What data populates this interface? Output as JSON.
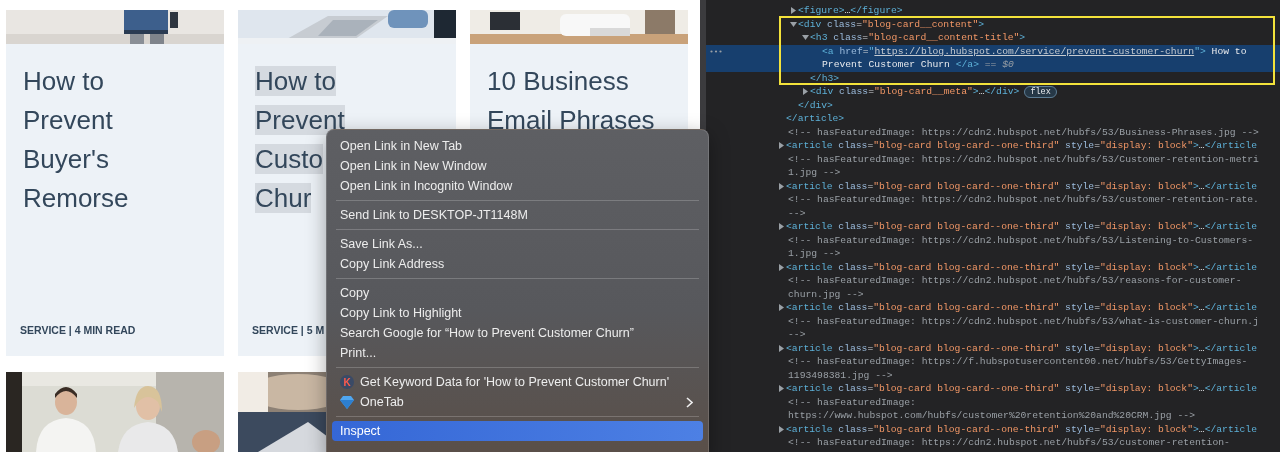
{
  "cards": [
    {
      "image": {
        "kind": "picture"
      },
      "title": [
        "How to",
        "Prevent",
        "Buyer's",
        "Remorse"
      ],
      "highlighted": false,
      "meta": "SERVICE | 4 MIN READ"
    },
    {
      "image": {
        "kind": "picture"
      },
      "title": [
        "How to",
        "Prevent",
        "Custo",
        "Chur"
      ],
      "highlighted": true,
      "meta": "SERVICE | 5 M"
    },
    {
      "image": {
        "kind": "picture"
      },
      "title": [
        "10 Business",
        "Email Phrases"
      ],
      "highlighted": false
    }
  ],
  "more_cards": [
    {
      "image": {
        "kind": "picture"
      }
    },
    {
      "image": {
        "kind": "picture"
      }
    }
  ],
  "context_menu": {
    "items": [
      {
        "kind": "item",
        "label": "Open Link in New Tab",
        "selected": false,
        "submenu": false
      },
      {
        "kind": "item",
        "label": "Open Link in New Window",
        "selected": false,
        "submenu": false
      },
      {
        "kind": "item",
        "label": "Open Link in Incognito Window",
        "selected": false,
        "submenu": false
      },
      {
        "kind": "separator"
      },
      {
        "kind": "item",
        "label": "Send Link to DESKTOP-JT1148M",
        "selected": false,
        "submenu": false
      },
      {
        "kind": "separator"
      },
      {
        "kind": "item",
        "label": "Save Link As...",
        "selected": false,
        "submenu": false
      },
      {
        "kind": "item",
        "label": "Copy Link Address",
        "selected": false,
        "submenu": false
      },
      {
        "kind": "separator"
      },
      {
        "kind": "item",
        "label": "Copy",
        "selected": false,
        "submenu": false
      },
      {
        "kind": "item",
        "label": "Copy Link to Highlight",
        "selected": false,
        "submenu": false
      },
      {
        "kind": "item",
        "label": "Search Google for “How to Prevent Customer Churn”",
        "selected": false,
        "submenu": false
      },
      {
        "kind": "item",
        "label": "Print...",
        "selected": false,
        "submenu": false
      },
      {
        "kind": "separator"
      },
      {
        "kind": "item",
        "label": "Get Keyword Data for 'How to Prevent Customer Churn'",
        "badge": "K",
        "selected": false,
        "submenu": false
      },
      {
        "kind": "gem-item",
        "label": "OneTab",
        "selected": false,
        "submenu": true
      },
      {
        "kind": "separator"
      },
      {
        "kind": "item",
        "label": "Inspect",
        "selected": true,
        "submenu": false
      }
    ]
  },
  "devtools": {
    "elements": [
      {
        "kind": "element",
        "children": [
          {
            "kind": "element",
            "expanded": false,
            "lines": [
              [
                {
                  "kind": "tag",
                  "text": "<figure>"
                },
                {
                  "kind": "text",
                  "text": "…"
                },
                {
                  "kind": "tag",
                  "text": "</figure>"
                }
              ]
            ]
          },
          {
            "kind": "element",
            "expanded": true,
            "lines": [
              [
                {
                  "kind": "tag",
                  "text": "<div"
                },
                {
                  "kind": "attr",
                  "text": " class"
                },
                {
                  "kind": "punct",
                  "text": "="
                },
                {
                  "kind": "value",
                  "text": "\"blog-card__content\""
                },
                {
                  "kind": "tag",
                  "text": ">"
                }
              ]
            ],
            "children": [
              {
                "kind": "element",
                "expanded": true,
                "lines": [
                  [
                    {
                      "kind": "tag",
                      "text": "<h3"
                    },
                    {
                      "kind": "attr",
                      "text": " class"
                    },
                    {
                      "kind": "punct",
                      "text": "="
                    },
                    {
                      "kind": "value",
                      "text": "\"blog-card__content-title\""
                    },
                    {
                      "kind": "tag",
                      "text": ">"
                    }
                  ]
                ],
                "children": [
                  {
                    "kind": "element",
                    "selected": true,
                    "lines": [
                      [
                        {
                          "kind": "tag",
                          "text": "<a"
                        },
                        {
                          "kind": "attr",
                          "text": " href"
                        },
                        {
                          "kind": "punct",
                          "text": "="
                        },
                        {
                          "kind": "tag",
                          "text": "\""
                        },
                        {
                          "kind": "link",
                          "text": "https://blog.hubspot.com/service/prevent-customer-churn"
                        },
                        {
                          "kind": "tag",
                          "text": "\">"
                        },
                        {
                          "kind": "text",
                          "text": " How to"
                        }
                      ],
                      [
                        {
                          "kind": "text",
                          "text": "Prevent Customer Churn "
                        },
                        {
                          "kind": "tag",
                          "text": "</a>"
                        },
                        {
                          "kind": "dim",
                          "text": " == $0"
                        }
                      ]
                    ]
                  }
                ],
                "close": [
                  {
                    "kind": "tag",
                    "text": "</h3>"
                  }
                ]
              },
              {
                "kind": "element",
                "expanded": false,
                "badge": "flex",
                "lines": [
                  [
                    {
                      "kind": "tag",
                      "text": "<div"
                    },
                    {
                      "kind": "attr",
                      "text": " class"
                    },
                    {
                      "kind": "punct",
                      "text": "="
                    },
                    {
                      "kind": "value",
                      "text": "\"blog-card__meta\""
                    },
                    {
                      "kind": "tag",
                      "text": ">"
                    },
                    {
                      "kind": "text",
                      "text": "…"
                    },
                    {
                      "kind": "tag",
                      "text": "</div>"
                    }
                  ]
                ]
              }
            ],
            "close": [
              {
                "kind": "tag",
                "text": "</div>"
              }
            ]
          }
        ],
        "close": [
          {
            "kind": "tag",
            "text": "</article>"
          }
        ]
      },
      {
        "kind": "comment",
        "lines": [
          [
            {
              "kind": "comment",
              "text": "<!-- hasFeaturedImage: https://cdn2.hubspot.net/hubfs/53/Business-Phrases.jpg -->"
            }
          ]
        ]
      },
      {
        "kind": "element",
        "expanded": false,
        "lines": [
          [
            {
              "kind": "tag",
              "text": "<article"
            },
            {
              "kind": "attr",
              "text": " class"
            },
            {
              "kind": "punct",
              "text": "="
            },
            {
              "kind": "value",
              "text": "\"blog-card blog-card--one-third\""
            },
            {
              "kind": "attr",
              "text": " style"
            },
            {
              "kind": "punct",
              "text": "="
            },
            {
              "kind": "value",
              "text": "\"display: block\""
            },
            {
              "kind": "tag",
              "text": ">"
            },
            {
              "kind": "text",
              "text": "…"
            },
            {
              "kind": "tag",
              "text": "</article"
            }
          ]
        ]
      },
      {
        "kind": "comment",
        "lines": [
          [
            {
              "kind": "comment",
              "text": "<!-- hasFeaturedImage: https://cdn2.hubspot.net/hubfs/53/Customer-retention-metri"
            }
          ],
          [
            {
              "kind": "comment",
              "text": "1.jpg -->"
            }
          ]
        ]
      },
      {
        "kind": "element",
        "expanded": false,
        "lines": [
          [
            {
              "kind": "tag",
              "text": "<article"
            },
            {
              "kind": "attr",
              "text": " class"
            },
            {
              "kind": "punct",
              "text": "="
            },
            {
              "kind": "value",
              "text": "\"blog-card blog-card--one-third\""
            },
            {
              "kind": "attr",
              "text": " style"
            },
            {
              "kind": "punct",
              "text": "="
            },
            {
              "kind": "value",
              "text": "\"display: block\""
            },
            {
              "kind": "tag",
              "text": ">"
            },
            {
              "kind": "text",
              "text": "…"
            },
            {
              "kind": "tag",
              "text": "</article"
            }
          ]
        ]
      },
      {
        "kind": "comment",
        "lines": [
          [
            {
              "kind": "comment",
              "text": "<!-- hasFeaturedImage: https://cdn2.hubspot.net/hubfs/53/customer-retention-rate."
            }
          ],
          [
            {
              "kind": "comment",
              "text": "-->"
            }
          ]
        ]
      },
      {
        "kind": "element",
        "expanded": false,
        "lines": [
          [
            {
              "kind": "tag",
              "text": "<article"
            },
            {
              "kind": "attr",
              "text": " class"
            },
            {
              "kind": "punct",
              "text": "="
            },
            {
              "kind": "value",
              "text": "\"blog-card blog-card--one-third\""
            },
            {
              "kind": "attr",
              "text": " style"
            },
            {
              "kind": "punct",
              "text": "="
            },
            {
              "kind": "value",
              "text": "\"display: block\""
            },
            {
              "kind": "tag",
              "text": ">"
            },
            {
              "kind": "text",
              "text": "…"
            },
            {
              "kind": "tag",
              "text": "</article"
            }
          ]
        ]
      },
      {
        "kind": "comment",
        "lines": [
          [
            {
              "kind": "comment",
              "text": "<!-- hasFeaturedImage: https://cdn2.hubspot.net/hubfs/53/Listening-to-Customers-"
            }
          ],
          [
            {
              "kind": "comment",
              "text": "1.jpg -->"
            }
          ]
        ]
      },
      {
        "kind": "element",
        "expanded": false,
        "lines": [
          [
            {
              "kind": "tag",
              "text": "<article"
            },
            {
              "kind": "attr",
              "text": " class"
            },
            {
              "kind": "punct",
              "text": "="
            },
            {
              "kind": "value",
              "text": "\"blog-card blog-card--one-third\""
            },
            {
              "kind": "attr",
              "text": " style"
            },
            {
              "kind": "punct",
              "text": "="
            },
            {
              "kind": "value",
              "text": "\"display: block\""
            },
            {
              "kind": "tag",
              "text": ">"
            },
            {
              "kind": "text",
              "text": "…"
            },
            {
              "kind": "tag",
              "text": "</article"
            }
          ]
        ]
      },
      {
        "kind": "comment",
        "lines": [
          [
            {
              "kind": "comment",
              "text": "<!-- hasFeaturedImage: https://cdn2.hubspot.net/hubfs/53/reasons-for-customer-"
            }
          ],
          [
            {
              "kind": "comment",
              "text": "churn.jpg -->"
            }
          ]
        ]
      },
      {
        "kind": "element",
        "expanded": false,
        "lines": [
          [
            {
              "kind": "tag",
              "text": "<article"
            },
            {
              "kind": "attr",
              "text": " class"
            },
            {
              "kind": "punct",
              "text": "="
            },
            {
              "kind": "value",
              "text": "\"blog-card blog-card--one-third\""
            },
            {
              "kind": "attr",
              "text": " style"
            },
            {
              "kind": "punct",
              "text": "="
            },
            {
              "kind": "value",
              "text": "\"display: block\""
            },
            {
              "kind": "tag",
              "text": ">"
            },
            {
              "kind": "text",
              "text": "…"
            },
            {
              "kind": "tag",
              "text": "</article"
            }
          ]
        ]
      },
      {
        "kind": "comment",
        "lines": [
          [
            {
              "kind": "comment",
              "text": "<!-- hasFeaturedImage: https://cdn2.hubspot.net/hubfs/53/what-is-customer-churn.j"
            }
          ],
          [
            {
              "kind": "comment",
              "text": "-->"
            }
          ]
        ]
      },
      {
        "kind": "element",
        "expanded": false,
        "lines": [
          [
            {
              "kind": "tag",
              "text": "<article"
            },
            {
              "kind": "attr",
              "text": " class"
            },
            {
              "kind": "punct",
              "text": "="
            },
            {
              "kind": "value",
              "text": "\"blog-card blog-card--one-third\""
            },
            {
              "kind": "attr",
              "text": " style"
            },
            {
              "kind": "punct",
              "text": "="
            },
            {
              "kind": "value",
              "text": "\"display: block\""
            },
            {
              "kind": "tag",
              "text": ">"
            },
            {
              "kind": "text",
              "text": "…"
            },
            {
              "kind": "tag",
              "text": "</article"
            }
          ]
        ]
      },
      {
        "kind": "comment",
        "lines": [
          [
            {
              "kind": "comment",
              "text": "<!-- hasFeaturedImage: https://f.hubspotusercontent00.net/hubfs/53/GettyImages-"
            }
          ],
          [
            {
              "kind": "comment",
              "text": "1193498381.jpg -->"
            }
          ]
        ]
      },
      {
        "kind": "element",
        "expanded": false,
        "lines": [
          [
            {
              "kind": "tag",
              "text": "<article"
            },
            {
              "kind": "attr",
              "text": " class"
            },
            {
              "kind": "punct",
              "text": "="
            },
            {
              "kind": "value",
              "text": "\"blog-card blog-card--one-third\""
            },
            {
              "kind": "attr",
              "text": " style"
            },
            {
              "kind": "punct",
              "text": "="
            },
            {
              "kind": "value",
              "text": "\"display: block\""
            },
            {
              "kind": "tag",
              "text": ">"
            },
            {
              "kind": "text",
              "text": "…"
            },
            {
              "kind": "tag",
              "text": "</article"
            }
          ]
        ]
      },
      {
        "kind": "comment",
        "lines": [
          [
            {
              "kind": "comment",
              "text": "<!-- hasFeaturedImage:"
            }
          ],
          [
            {
              "kind": "comment",
              "text": "https://www.hubspot.com/hubfs/customer%20retention%20and%20CRM.jpg -->"
            }
          ]
        ]
      },
      {
        "kind": "element",
        "expanded": false,
        "lines": [
          [
            {
              "kind": "tag",
              "text": "<article"
            },
            {
              "kind": "attr",
              "text": " class"
            },
            {
              "kind": "punct",
              "text": "="
            },
            {
              "kind": "value",
              "text": "\"blog-card blog-card--one-third\""
            },
            {
              "kind": "attr",
              "text": " style"
            },
            {
              "kind": "punct",
              "text": "="
            },
            {
              "kind": "value",
              "text": "\"display: block\""
            },
            {
              "kind": "tag",
              "text": ">"
            },
            {
              "kind": "text",
              "text": "…"
            },
            {
              "kind": "tag",
              "text": "</article"
            }
          ]
        ]
      },
      {
        "kind": "comment",
        "lines": [
          [
            {
              "kind": "comment",
              "text": "<!-- hasFeaturedImage: https://cdn2.hubspot.net/hubfs/53/customer-retention-"
            }
          ]
        ]
      }
    ]
  }
}
